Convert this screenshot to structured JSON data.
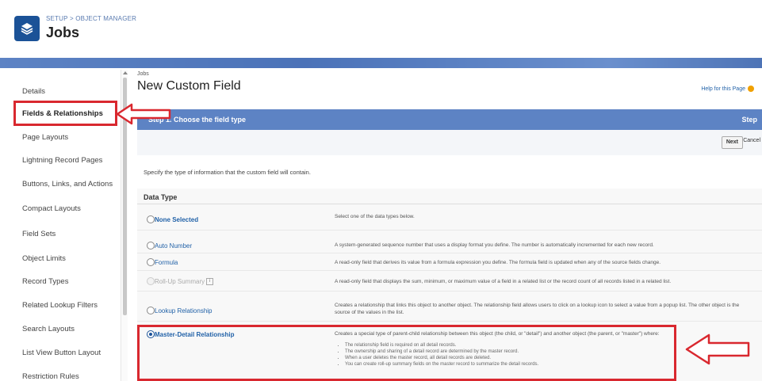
{
  "header": {
    "breadcrumb": "SETUP > OBJECT MANAGER",
    "title": "Jobs"
  },
  "sidebar": {
    "items": [
      {
        "label": "Details"
      },
      {
        "label": "Fields & Relationships",
        "selected": true
      },
      {
        "label": "Page Layouts"
      },
      {
        "label": "Lightning Record Pages"
      },
      {
        "label": "Buttons, Links, and Actions"
      },
      {
        "label": "Compact Layouts"
      },
      {
        "label": "Field Sets"
      },
      {
        "label": "Object Limits"
      },
      {
        "label": "Record Types"
      },
      {
        "label": "Related Lookup Filters"
      },
      {
        "label": "Search Layouts"
      },
      {
        "label": "List View Button Layout"
      },
      {
        "label": "Restriction Rules"
      }
    ]
  },
  "main": {
    "subtitle": "Jobs",
    "title": "New Custom Field",
    "help_link": "Help for this Page",
    "step_label": "Step 1. Choose the field type",
    "step_count": "Step",
    "next_button": "Next",
    "cancel_button": "Cancel",
    "specify_text": "Specify the type of information that the custom field will contain.",
    "data_type_header": "Data Type",
    "options": [
      {
        "label": "None Selected",
        "desc": "Select one of the data types below.",
        "checked": false,
        "disabled": false
      },
      {
        "label": "Auto Number",
        "desc": "A system-generated sequence number that uses a display format you define. The number is automatically incremented for each new record.",
        "checked": false,
        "disabled": false
      },
      {
        "label": "Formula",
        "desc": "A read-only field that derives its value from a formula expression you define. The formula field is updated when any of the source fields change.",
        "checked": false,
        "disabled": false
      },
      {
        "label": "Roll-Up Summary",
        "desc": "A read-only field that displays the sum, minimum, or maximum value of a field in a related list or the record count of all records listed in a related list.",
        "checked": false,
        "disabled": true
      },
      {
        "label": "Lookup Relationship",
        "desc": "Creates a relationship that links this object to another object. The relationship field allows users to click on a lookup icon to select a value from a popup list. The other object is the source of the values in the list.",
        "checked": false,
        "disabled": false
      },
      {
        "label": "Master-Detail Relationship",
        "desc": "Creates a special type of parent-child relationship between this object (the child, or \"detail\") and another object (the parent, or \"master\") where:",
        "checked": true,
        "disabled": false
      }
    ],
    "md_bullets": [
      "The relationship field is required on all detail records.",
      "The ownership and sharing of a detail record are determined by the master record.",
      "When a user deletes the master record, all detail records are deleted.",
      "You can create roll-up summary fields on the master record to summarize the detail records."
    ]
  },
  "colors": {
    "band": "#5d83c4",
    "highlight": "#d9282f",
    "app_icon": "#1b5297"
  },
  "icons": [
    "layers-icon",
    "help-icon",
    "info-icon",
    "arrow-left-annotation-icon",
    "arrow-right-annotation-icon"
  ]
}
